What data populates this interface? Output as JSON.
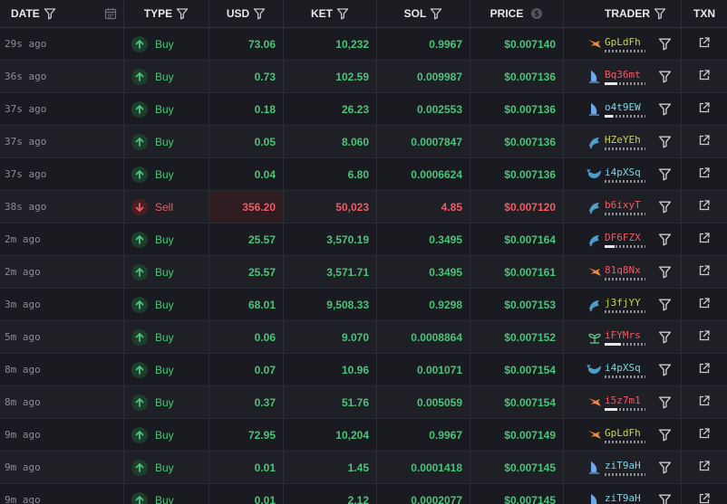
{
  "header": {
    "date": "DATE",
    "type": "TYPE",
    "usd": "USD",
    "ket": "KET",
    "sol": "SOL",
    "price": "PRICE",
    "trader": "TRADER",
    "txn": "TXN"
  },
  "colors": {
    "buy": "#4cc37a",
    "sell": "#ef5a64",
    "background": "#1a1b20"
  },
  "rows": [
    {
      "date": "29s ago",
      "type": "Buy",
      "usd": "73.06",
      "ket": "10,232",
      "sol": "0.9967",
      "price": "$0.007140",
      "trader": "GpLdFh",
      "trader_color": "#c8d45a",
      "icon": "bird-icon",
      "icon_color": "#f08a3a",
      "bar": 0
    },
    {
      "date": "36s ago",
      "type": "Buy",
      "usd": "0.73",
      "ket": "102.59",
      "sol": "0.009987",
      "price": "$0.007136",
      "trader": "Bq36mt",
      "trader_color": "#ef5a64",
      "icon": "sail-icon",
      "icon_color": "#6aa8e8",
      "bar": 0.3
    },
    {
      "date": "37s ago",
      "type": "Buy",
      "usd": "0.18",
      "ket": "26.23",
      "sol": "0.002553",
      "price": "$0.007136",
      "trader": "o4t9EW",
      "trader_color": "#7fd3e6",
      "icon": "sail-icon",
      "icon_color": "#6aa8e8",
      "bar": 0.2
    },
    {
      "date": "37s ago",
      "type": "Buy",
      "usd": "0.05",
      "ket": "8.060",
      "sol": "0.0007847",
      "price": "$0.007136",
      "trader": "HZeYEh",
      "trader_color": "#c8d45a",
      "icon": "dolphin-icon",
      "icon_color": "#4d9fc9",
      "bar": 0
    },
    {
      "date": "37s ago",
      "type": "Buy",
      "usd": "0.04",
      "ket": "6.80",
      "sol": "0.0006624",
      "price": "$0.007136",
      "trader": "i4pXSq",
      "trader_color": "#7fd3e6",
      "icon": "whale-icon",
      "icon_color": "#4d9fc9",
      "bar": 0
    },
    {
      "date": "38s ago",
      "type": "Sell",
      "usd": "356.20",
      "ket": "50,023",
      "sol": "4.85",
      "price": "$0.007120",
      "trader": "b6ixyT",
      "trader_color": "#ef5a64",
      "icon": "dolphin-icon",
      "icon_color": "#4d9fc9",
      "bar": 0
    },
    {
      "date": "2m ago",
      "type": "Buy",
      "usd": "25.57",
      "ket": "3,570.19",
      "sol": "0.3495",
      "price": "$0.007164",
      "trader": "DF6FZX",
      "trader_color": "#ef5a64",
      "icon": "dolphin-icon",
      "icon_color": "#4d9fc9",
      "bar": 0.25
    },
    {
      "date": "2m ago",
      "type": "Buy",
      "usd": "25.57",
      "ket": "3,571.71",
      "sol": "0.3495",
      "price": "$0.007161",
      "trader": "81q8Nx",
      "trader_color": "#ef5a64",
      "icon": "bird-icon",
      "icon_color": "#f08a3a",
      "bar": 0
    },
    {
      "date": "3m ago",
      "type": "Buy",
      "usd": "68.01",
      "ket": "9,508.33",
      "sol": "0.9298",
      "price": "$0.007153",
      "trader": "j3fjYY",
      "trader_color": "#c8d45a",
      "icon": "dolphin-icon",
      "icon_color": "#4d9fc9",
      "bar": 0
    },
    {
      "date": "5m ago",
      "type": "Buy",
      "usd": "0.06",
      "ket": "9.070",
      "sol": "0.0008864",
      "price": "$0.007152",
      "trader": "iFYMrs",
      "trader_color": "#ef5a64",
      "icon": "plant-icon",
      "icon_color": "#5bbf7a",
      "bar": 0.4
    },
    {
      "date": "8m ago",
      "type": "Buy",
      "usd": "0.07",
      "ket": "10.96",
      "sol": "0.001071",
      "price": "$0.007154",
      "trader": "i4pXSq",
      "trader_color": "#7fd3e6",
      "icon": "whale-icon",
      "icon_color": "#4d9fc9",
      "bar": 0
    },
    {
      "date": "8m ago",
      "type": "Buy",
      "usd": "0.37",
      "ket": "51.76",
      "sol": "0.005059",
      "price": "$0.007154",
      "trader": "i5z7m1",
      "trader_color": "#ef5a64",
      "icon": "bird-icon",
      "icon_color": "#f08a3a",
      "bar": 0.3
    },
    {
      "date": "9m ago",
      "type": "Buy",
      "usd": "72.95",
      "ket": "10,204",
      "sol": "0.9967",
      "price": "$0.007149",
      "trader": "GpLdFh",
      "trader_color": "#c8d45a",
      "icon": "bird-icon",
      "icon_color": "#f08a3a",
      "bar": 0
    },
    {
      "date": "9m ago",
      "type": "Buy",
      "usd": "0.01",
      "ket": "1.45",
      "sol": "0.0001418",
      "price": "$0.007145",
      "trader": "ziT9aH",
      "trader_color": "#7fd3e6",
      "icon": "sail-icon",
      "icon_color": "#6aa8e8",
      "bar": 0
    },
    {
      "date": "9m ago",
      "type": "Buy",
      "usd": "0.01",
      "ket": "2.12",
      "sol": "0.0002077",
      "price": "$0.007145",
      "trader": "ziT9aH",
      "trader_color": "#7fd3e6",
      "icon": "sail-icon",
      "icon_color": "#6aa8e8",
      "bar": 0
    }
  ]
}
